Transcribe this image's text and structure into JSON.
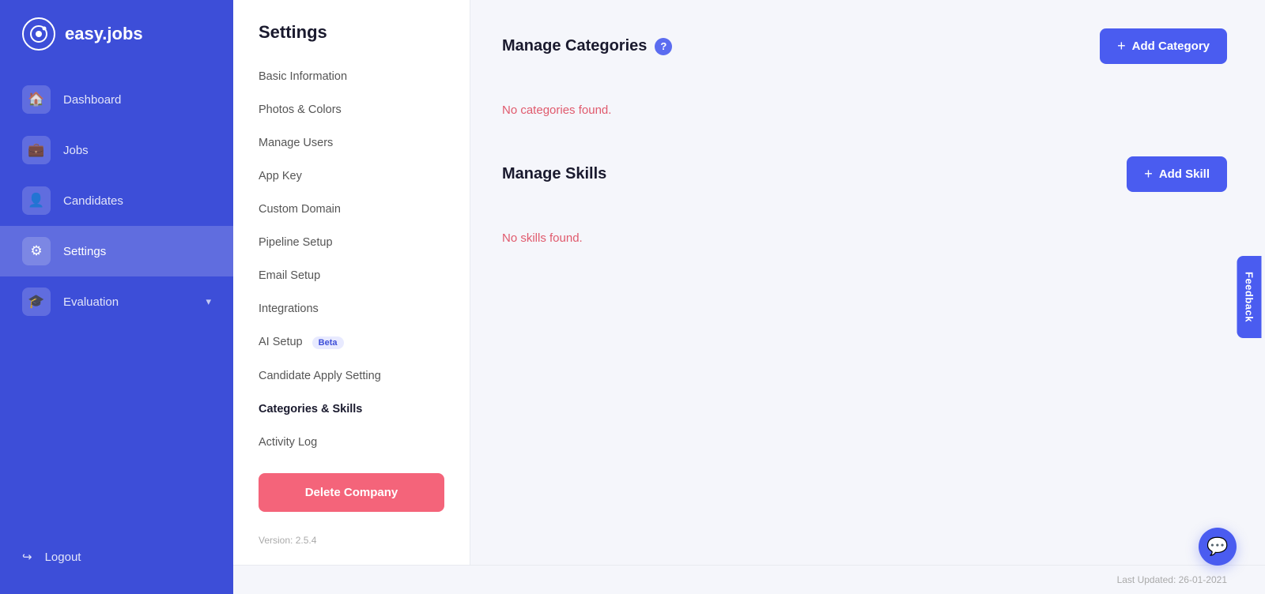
{
  "app": {
    "logo_text": "easy.jobs",
    "logo_icon": "Q"
  },
  "sidebar": {
    "nav_items": [
      {
        "id": "dashboard",
        "label": "Dashboard",
        "icon": "🏠",
        "active": false
      },
      {
        "id": "jobs",
        "label": "Jobs",
        "icon": "💼",
        "active": false
      },
      {
        "id": "candidates",
        "label": "Candidates",
        "icon": "👤",
        "active": false
      },
      {
        "id": "settings",
        "label": "Settings",
        "icon": "⚙",
        "active": true
      },
      {
        "id": "evaluation",
        "label": "Evaluation",
        "icon": "🎓",
        "active": false,
        "has_chevron": true
      }
    ],
    "logout_label": "Logout"
  },
  "settings_page": {
    "title": "Settings",
    "menu_items": [
      {
        "id": "basic-information",
        "label": "Basic Information",
        "active": false
      },
      {
        "id": "photos-colors",
        "label": "Photos & Colors",
        "active": false
      },
      {
        "id": "manage-users",
        "label": "Manage Users",
        "active": false
      },
      {
        "id": "app-key",
        "label": "App Key",
        "active": false
      },
      {
        "id": "custom-domain",
        "label": "Custom Domain",
        "active": false
      },
      {
        "id": "pipeline-setup",
        "label": "Pipeline Setup",
        "active": false
      },
      {
        "id": "email-setup",
        "label": "Email Setup",
        "active": false
      },
      {
        "id": "integrations",
        "label": "Integrations",
        "active": false
      },
      {
        "id": "ai-setup",
        "label": "AI Setup",
        "active": false,
        "badge": "Beta"
      },
      {
        "id": "candidate-apply-setting",
        "label": "Candidate Apply Setting",
        "active": false
      },
      {
        "id": "categories-skills",
        "label": "Categories & Skills",
        "active": true
      },
      {
        "id": "activity-log",
        "label": "Activity Log",
        "active": false
      }
    ],
    "delete_button_label": "Delete Company",
    "version_text": "Version: 2.5.4"
  },
  "main": {
    "categories_section": {
      "title": "Manage Categories",
      "add_button_label": "Add Category",
      "empty_message": "No categories found."
    },
    "skills_section": {
      "title": "Manage Skills",
      "add_button_label": "Add Skill",
      "empty_message": "No skills found."
    }
  },
  "footer": {
    "last_updated": "Last Updated: 26-01-2021"
  },
  "feedback": {
    "label": "Feedback"
  },
  "chat": {
    "icon": "💬"
  }
}
